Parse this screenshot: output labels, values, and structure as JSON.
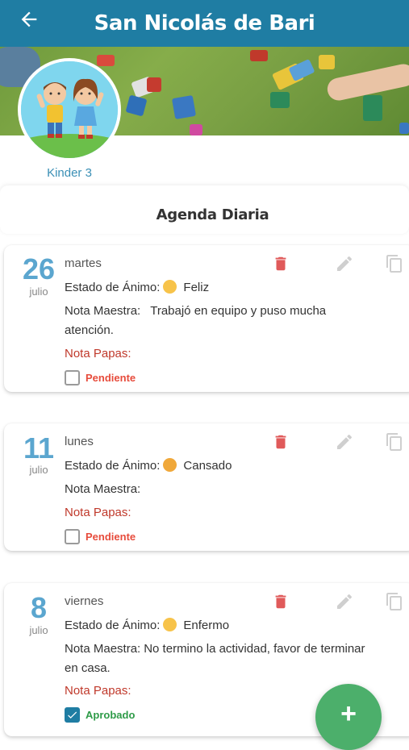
{
  "header": {
    "title": "San Nicolás de Bari",
    "back_icon": "arrow-left-icon"
  },
  "profile": {
    "class_name": "Kinder 3"
  },
  "section": {
    "title": "Agenda Diaria"
  },
  "labels": {
    "mood": "Estado de Ánimo:",
    "teacher_note": "Nota Maestra:",
    "parents_note": "Nota Papas:"
  },
  "entries": [
    {
      "day": "26",
      "month": "julio",
      "weekday": "martes",
      "mood": "Feliz",
      "mood_color": "#f7c34a",
      "teacher_note": "Trabajó en equipo y puso mucha atención.",
      "status": "Pendiente",
      "checked": false
    },
    {
      "day": "11",
      "month": "julio",
      "weekday": "lunes",
      "mood": "Cansado",
      "mood_color": "#f0a83a",
      "teacher_note": "",
      "status": "Pendiente",
      "checked": false
    },
    {
      "day": "8",
      "month": "julio",
      "weekday": "viernes",
      "mood": "Enfermo",
      "mood_color": "#f7c34a",
      "teacher_note": "No termino la actividad, favor de terminar en casa.",
      "status": "Aprobado",
      "checked": true
    }
  ],
  "colors": {
    "primary": "#1f7da3",
    "accent_day": "#5ba6cf",
    "delete": "#e05a5a",
    "pending": "#e74c3c",
    "approved": "#2e9b48",
    "fab": "#4caf6b"
  },
  "fab": {
    "icon": "plus-icon",
    "label": "+"
  }
}
